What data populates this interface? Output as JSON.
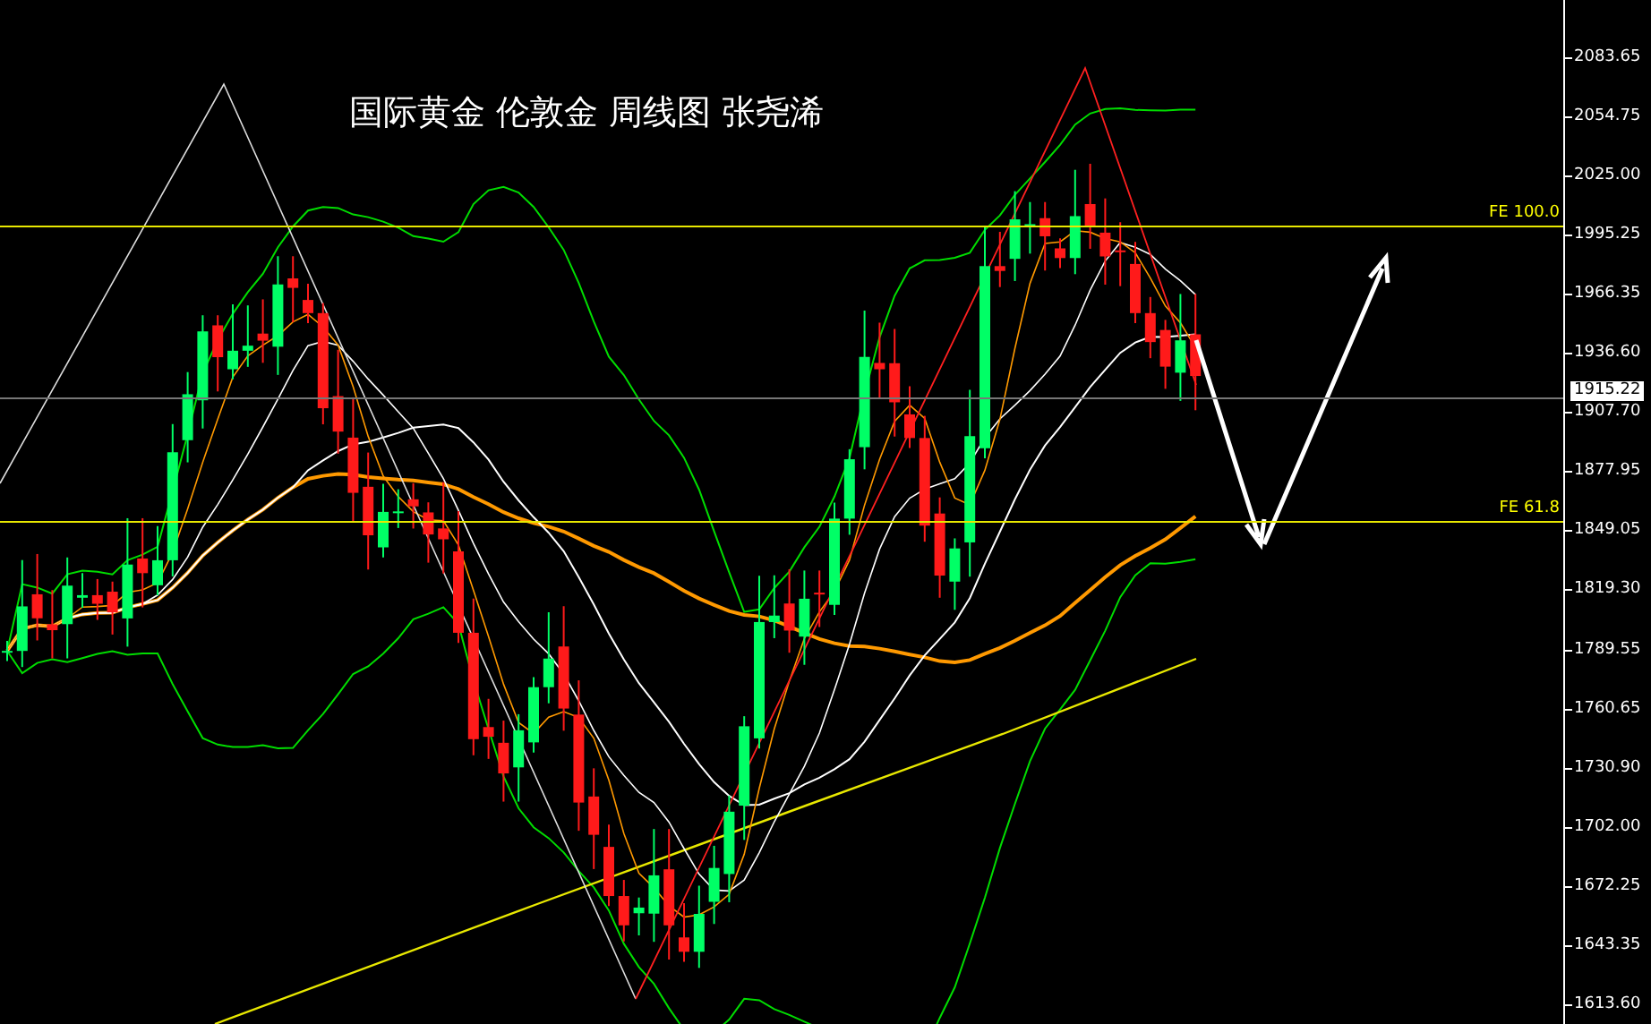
{
  "chart": {
    "title": "国际黄金 伦敦金 周线图 张尧浠",
    "price_axis": {
      "labels": [
        "2083.65",
        "2054.75",
        "2025.00",
        "1995.25",
        "1966.35",
        "1936.60",
        "1907.70",
        "1877.95",
        "1849.05",
        "1819.30",
        "1789.55",
        "1760.65",
        "1730.90",
        "1702.00",
        "1672.25",
        "1643.35",
        "1613.60"
      ]
    },
    "current_price": "1915.22",
    "levels": [
      {
        "label": "FE 100.0"
      },
      {
        "label": "FE 61.8"
      }
    ]
  }
}
